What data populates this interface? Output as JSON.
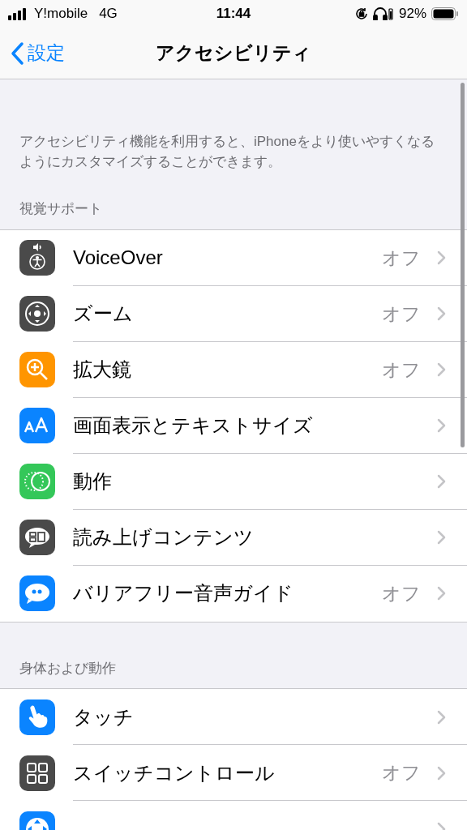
{
  "status_bar": {
    "carrier": "Y!mobile",
    "network": "4G",
    "time": "11:44",
    "battery": "92%"
  },
  "nav": {
    "back": "設定",
    "title": "アクセシビリティ"
  },
  "description": "アクセシビリティ機能を利用すると、iPhoneをより使いやすくなるようにカスタマイズすることができます。",
  "sections": [
    {
      "header": "視覚サポート",
      "items": [
        {
          "kind": "voiceover",
          "color": "#4a4a4a",
          "label": "VoiceOver",
          "value": "オフ"
        },
        {
          "kind": "zoom",
          "color": "#4a4a4a",
          "label": "ズーム",
          "value": "オフ"
        },
        {
          "kind": "magnifier",
          "color": "#ff9500",
          "label": "拡大鏡",
          "value": "オフ"
        },
        {
          "kind": "text",
          "color": "#0a84ff",
          "label": "画面表示とテキストサイズ"
        },
        {
          "kind": "motion",
          "color": "#34c759",
          "label": "動作"
        },
        {
          "kind": "speech",
          "color": "#4a4a4a",
          "label": "読み上げコンテンツ"
        },
        {
          "kind": "quote",
          "color": "#0a84ff",
          "label": "バリアフリー音声ガイド",
          "value": "オフ"
        }
      ]
    },
    {
      "header": "身体および動作",
      "items": [
        {
          "kind": "touch",
          "color": "#0a84ff",
          "label": "タッチ"
        },
        {
          "kind": "switch",
          "color": "#4a4a4a",
          "label": "スイッチコントロール",
          "value": "オフ"
        },
        {
          "kind": "voicecontrol",
          "color": "#0a84ff"
        }
      ]
    }
  ]
}
